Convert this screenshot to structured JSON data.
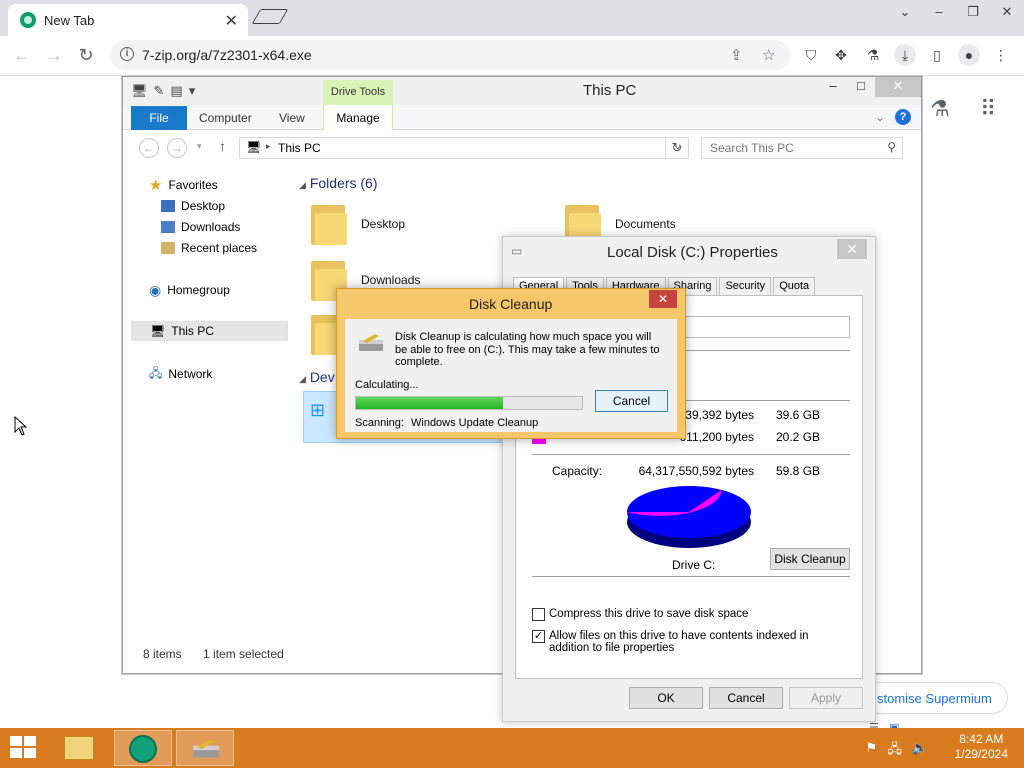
{
  "browser": {
    "tab_title": "New Tab",
    "tab_close": "✕",
    "url": "7-zip.org/a/7z2301-x64.exe",
    "win_minimize": "⌄",
    "win_min": "–",
    "win_restore": "❐",
    "win_close": "✕"
  },
  "supermium_button": "stomise Supermium",
  "explorer": {
    "title": "This PC",
    "drive_tools": "Drive Tools",
    "ribbon_tabs": {
      "file": "File",
      "computer": "Computer",
      "view": "View",
      "manage": "Manage"
    },
    "address": "This PC",
    "search_placeholder": "Search This PC",
    "nav": {
      "favorites": "Favorites",
      "desktop": "Desktop",
      "downloads": "Downloads",
      "recent": "Recent places",
      "homegroup": "Homegroup",
      "this_pc": "This PC",
      "network": "Network"
    },
    "folders_group": "Folders (6)",
    "devices_group": "Dev",
    "folders": {
      "desktop": "Desktop",
      "documents": "Documents",
      "downloads": "Downloads"
    },
    "status": {
      "items": "8 items",
      "selected": "1 item selected"
    }
  },
  "properties": {
    "title": "Local Disk (C:) Properties",
    "tabs": [
      "General",
      "Tools",
      "Hardware",
      "Sharing",
      "Security",
      "Quota"
    ],
    "used_bytes": "939,392 bytes",
    "used_gb": "39.6 GB",
    "free_bytes": "611,200 bytes",
    "free_gb": "20.2 GB",
    "capacity_label": "Capacity:",
    "capacity_bytes": "64,317,550,592 bytes",
    "capacity_gb": "59.8 GB",
    "drive_label": "Drive C:",
    "disk_cleanup_button": "Disk Cleanup",
    "compress_label": "Compress this drive to save disk space",
    "index_label": "Allow files on this drive to have contents indexed in addition to file properties",
    "compress_checked": false,
    "index_checked": true,
    "ok": "OK",
    "cancel": "Cancel",
    "apply": "Apply",
    "used_color": "#0000ff",
    "free_color": "#ff00ff",
    "used_fraction": 0.662
  },
  "disk_cleanup": {
    "title": "Disk Cleanup",
    "message": "Disk Cleanup is calculating how much space you will be able to free on  (C:). This may take a few minutes to complete.",
    "calculating": "Calculating...",
    "progress_fraction": 0.65,
    "cancel": "Cancel",
    "scanning_label": "Scanning:",
    "scanning_item": "Windows Update Cleanup"
  },
  "taskbar": {
    "time": "8:42 AM",
    "date": "1/29/2024"
  }
}
